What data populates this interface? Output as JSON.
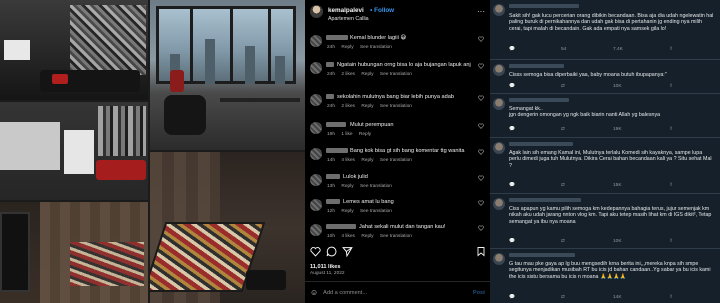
{
  "instagram": {
    "username": "kemalpalevi",
    "follow_label": "• Follow",
    "location": "Apartemen Callia",
    "comments": [
      {
        "text": "Kemal blunder lagiii 😅",
        "time": "24h",
        "likes": "",
        "reply": "Reply",
        "translate": "See translation"
      },
      {
        "text": "Ngatain hubungan orng bisa lo aja bujangan lapuk anj",
        "time": "24h",
        "likes": "2 likes",
        "reply": "Reply",
        "translate": "See translation"
      },
      {
        "text": "sekolahin mulutnya bang biar lebih punya adab",
        "time": "24h",
        "likes": "2 likes",
        "reply": "Reply",
        "translate": "See translation"
      },
      {
        "text": "Mulut perempuan",
        "time": "19h",
        "likes": "1 like",
        "reply": "Reply",
        "translate": ""
      },
      {
        "text": "Bang kok bisa gt sih bang komentar ttg wanita",
        "time": "14h",
        "likes": "4 likes",
        "reply": "Reply",
        "translate": "See translation"
      },
      {
        "text": "Lulok julid",
        "time": "13h",
        "likes": "",
        "reply": "Reply",
        "translate": "See translation"
      },
      {
        "text": "Lemes amat lu bang",
        "time": "12h",
        "likes": "",
        "reply": "Reply",
        "translate": "See translation"
      },
      {
        "text": "Jahat sekali mulut dan tangan kau!",
        "time": "10h",
        "likes": "4 likes",
        "reply": "Reply",
        "translate": "See translation"
      }
    ],
    "likes_count": "11,011 likes",
    "date": "August 11, 2022",
    "add_comment_placeholder": "Add a comment...",
    "post_label": "Post"
  },
  "twitter": {
    "tweets": [
      {
        "text": "Sakit sih! gak lucu percerian orang dibikin becandaan. Bisa aja dia udah ngelewatin hal paling buruk di pernikahannya dan udah gak bisa di pertahanin jg ending nya milih cerai, tapi malah di becandain. Gak ada empati nya samsek gila lo!",
        "replies": "",
        "retweets": "54",
        "likes": "7.4K",
        "views": ""
      },
      {
        "text": "Cisss semoga bisa diperbaiki yaa, baby moana butuh ibupapanya:\"",
        "replies": "",
        "retweets": "",
        "likes": "10K",
        "views": ""
      },
      {
        "text": "Semangat kk..\njgn dengerin omongan yg ngk baik biarin nanti Allah yg balesnya",
        "replies": "",
        "retweets": "",
        "likes": "19K",
        "views": ""
      },
      {
        "text": "Agak lain sih emang Kamal ini, Mulutnya terlalu Komedi sih kayaknya, sampe lupa perlu dimedi juga tuh Mulutnya. Dikira Cerai bahan becandaan kali ya ? Situ sehat Mal ?",
        "replies": "",
        "retweets": "",
        "likes": "15K",
        "views": ""
      },
      {
        "text": "Ciss apapun yg kamu pilih semoga km kedepannya bahagia terus, jujur semenjak km nikah aku udah jarang nnton vlog km. Tapi aku tetep masih lihat km di IGS dikit², Tetap semangat ya ibu nya moana",
        "replies": "",
        "retweets": "",
        "likes": "10K",
        "views": ""
      },
      {
        "text": "G tau mau pke gaya ap lg buu mengsedih krna berita ini,,,mereka knpa sih smpe segitunya menjadikan musibah RT bu icis jd bahan candaan..Yg sabar ya bu icis kami the icis sistu bersama bu icis n moana 🙏🙏🙏🙏",
        "replies": "",
        "retweets": "",
        "likes": "14K",
        "views": ""
      }
    ]
  },
  "colors": {
    "ig_bg": "#000000",
    "tw_bg": "#15202b",
    "follow_blue": "#3897f0",
    "meta_gray": "#a8a8a8"
  }
}
